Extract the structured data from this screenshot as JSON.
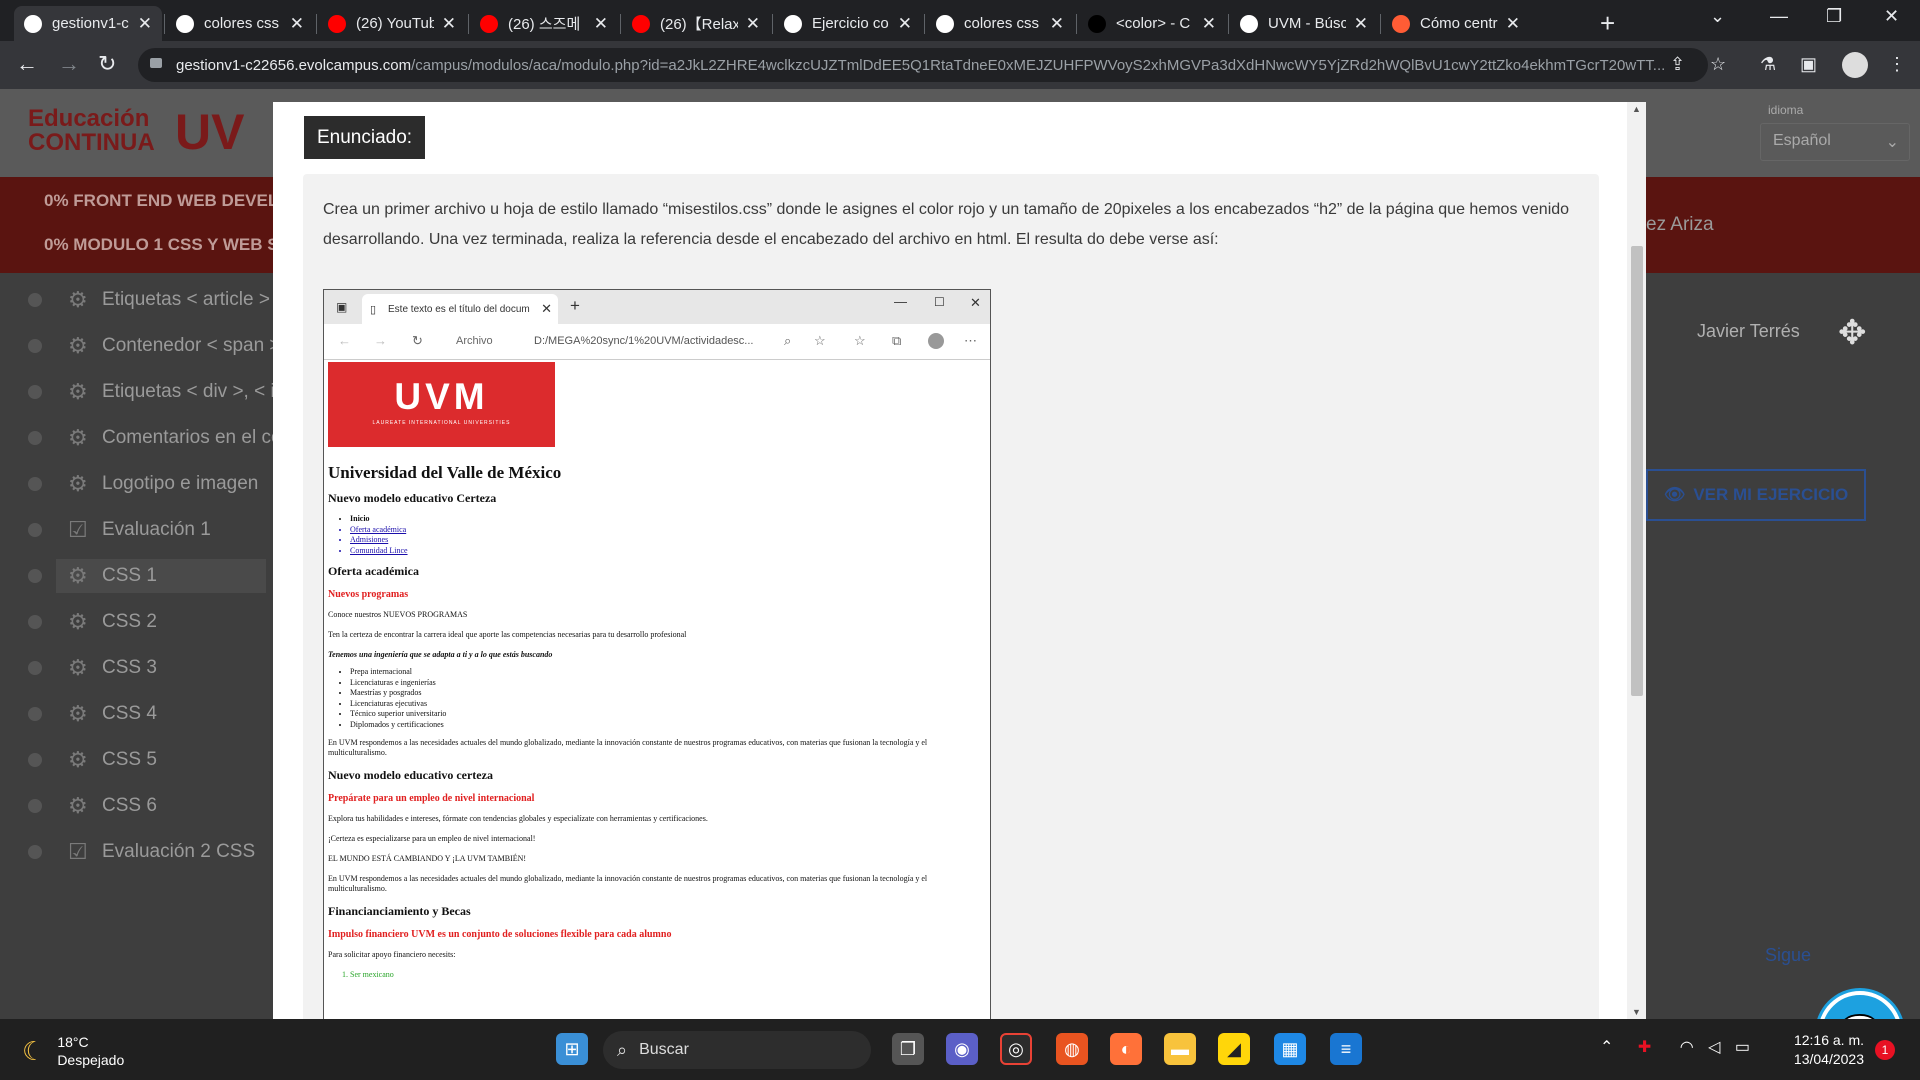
{
  "browser": {
    "tabs": [
      {
        "title": "gestionv1-c",
        "icon": "page-icon",
        "fav": "#ffffff"
      },
      {
        "title": "colores css",
        "icon": "google-icon",
        "fav": "#ffffff"
      },
      {
        "title": "(26) YouTub",
        "icon": "youtube-icon",
        "fav": "#ff0000"
      },
      {
        "title": "(26) 스즈메",
        "icon": "youtube-icon",
        "fav": "#ff0000"
      },
      {
        "title": "(26)【Relaxi",
        "icon": "youtube-icon",
        "fav": "#ff0000"
      },
      {
        "title": "Ejercicio co",
        "icon": "globe-icon",
        "fav": "#ffffff"
      },
      {
        "title": "colores css",
        "icon": "google-icon",
        "fav": "#ffffff"
      },
      {
        "title": "<color> - C",
        "icon": "mdn-icon",
        "fav": "#000000"
      },
      {
        "title": "UVM - Búsc",
        "icon": "google-icon",
        "fav": "#ffffff"
      },
      {
        "title": "Cómo centr",
        "icon": "hubspot-icon",
        "fav": "#ff5c35"
      }
    ],
    "url_host": "gestionv1-c22656.evolcampus.com",
    "url_path": "/campus/modulos/aca/modulo.php?id=a2JkL2ZHRE4wclkzcUJZTmlDdEE5Q1RtaTdneE0xMEJZUHFPWVoyS2xhMGVPa3dXdHNwcWY5YjZRd2hWQlBvU1cwY2ttZko4ekhmTGcrT20wTT..."
  },
  "background": {
    "logo_line1": "Educación",
    "logo_line2": "CONTINUA",
    "logo_uvm": "UV",
    "programs": [
      "0%  FRONT END WEB DEVELOPE",
      "0%  MODULO 1 CSS Y WEB S"
    ],
    "sidebar": [
      {
        "label": "Etiquetas < article > y",
        "icon": "gear-icon"
      },
      {
        "label": "Contenedor < span > y",
        "icon": "gear-icon"
      },
      {
        "label": "Etiquetas < div >, < i >",
        "icon": "gear-icon"
      },
      {
        "label": "Comentarios en el có",
        "icon": "gear-icon"
      },
      {
        "label": "Logotipo e imagen",
        "icon": "gear-icon"
      },
      {
        "label": "Evaluación 1",
        "icon": "checkbox-icon"
      },
      {
        "label": "CSS 1",
        "icon": "gear-icon"
      },
      {
        "label": "CSS 2",
        "icon": "gear-icon"
      },
      {
        "label": "CSS 3",
        "icon": "gear-icon"
      },
      {
        "label": "CSS 4",
        "icon": "gear-icon"
      },
      {
        "label": "CSS 5",
        "icon": "gear-icon"
      },
      {
        "label": "CSS 6",
        "icon": "gear-icon"
      },
      {
        "label": "Evaluación 2 CSS",
        "icon": "checkbox-icon"
      }
    ],
    "user_partial": "ez Ariza",
    "user_name": "Javier Terrés",
    "language_label": "idioma",
    "language_value": "Español",
    "ver_ejercicio": "VER MI EJERCICIO",
    "sigue": "Sigue"
  },
  "modal": {
    "heading": "Enunciado:",
    "instructions": "Crea un primer archivo u hoja de estilo llamado “misestilos.css” donde le asignes el color rojo y un tamaño de 20pixeles a los encabezados “h2” de la página que hemos venido desarrollando. Una vez terminada, realiza la referencia desde el encabezado del archivo en html. El resulta do debe verse así:",
    "example": {
      "tab_title": "Este texto es el título del docum",
      "url_label": "Archivo",
      "url": "D:/MEGA%20sync/1%20UVM/actividadesc...",
      "logo_text": "UVM",
      "logo_sub": "LAUREATE INTERNATIONAL UNIVERSITIES",
      "h1": "Universidad del Valle de México",
      "h3_model": "Nuevo modelo educativo Certeza",
      "nav": [
        "Inicio",
        "Oferta académica",
        "Admisiones",
        "Comunidad Lince"
      ],
      "h2_oferta": "Oferta académica",
      "h4_nuevos": "Nuevos programas",
      "p1": "Conoce nuestros NUEVOS PROGRAMAS",
      "p2": "Ten la certeza de encontrar la carrera ideal que aporte las competencias necesarias para tu desarrollo profesional",
      "p3": "Tenemos una ingeniería que se adapta a ti y a lo que estás buscando",
      "programs": [
        "Prepa internacional",
        "Licenciaturas e ingenierías",
        "Maestrías y posgrados",
        "Licenciaturas ejecutivas",
        "Técnico superior universitario",
        "Diplomados y certificaciones"
      ],
      "p4": "En UVM respondemos a las necesidades actuales del mundo globalizado, mediante la innovación constante de nuestros programas educativos, con materias que fusionan la tecnología y el multiculturalismo.",
      "h2_modelo": "Nuevo modelo educativo certeza",
      "h4_prepara": "Prepárate para un empleo de nivel internacional",
      "p5": "Explora tus habilidades e intereses, fórmate con tendencias globales y especialízate con herramientas y certificaciones.",
      "p6": "¡Certeza es especializarse para un empleo de nivel internacional!",
      "p7": "EL MUNDO ESTÁ CAMBIANDO Y ¡LA UVM TAMBIÉN!",
      "p8": "En UVM respondemos a las necesidades actuales del mundo globalizado, mediante la innovación constante de nuestros programas educativos, con materias que fusionan la tecnología y el multiculturalismo.",
      "h2_fin": "Financianciamiento y Becas",
      "h4_impulso": "Impulso financiero UVM es un conjunto de soluciones flexible para cada alumno",
      "p9": "Para solicitar apoyo financiero necesits:",
      "ol_first": "Ser mexicano"
    }
  },
  "taskbar": {
    "temperature": "18°C",
    "weather": "Despejado",
    "search": "Buscar",
    "time": "12:16 a. m.",
    "date": "13/04/2023",
    "notifications": "1"
  },
  "colors": {
    "accent_red": "#e12020",
    "uvm_red": "#dc2b2d",
    "link_blue": "#2a4f92"
  }
}
